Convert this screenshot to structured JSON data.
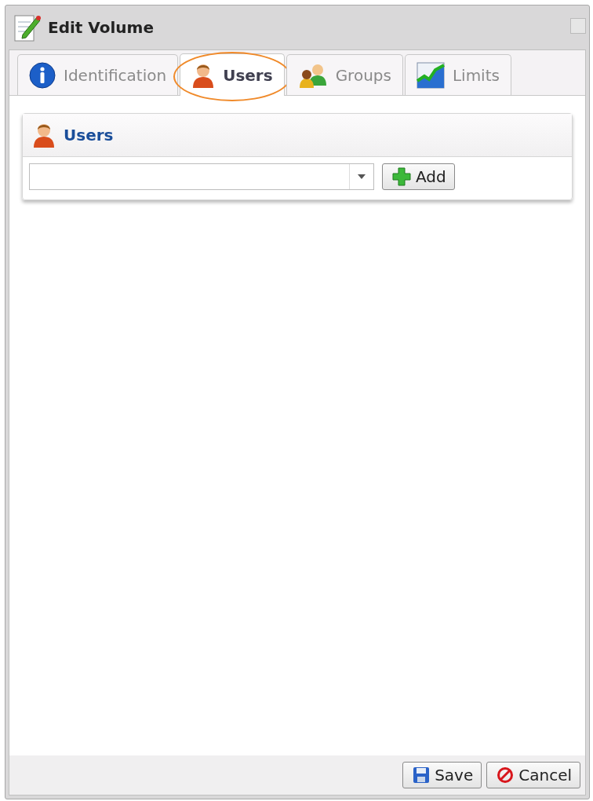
{
  "window": {
    "title": "Edit Volume"
  },
  "tabs": [
    {
      "label": "Identification",
      "kind": "info",
      "selected": false,
      "highlighted": false
    },
    {
      "label": "Users",
      "kind": "user",
      "selected": true,
      "highlighted": true
    },
    {
      "label": "Groups",
      "kind": "group",
      "selected": false,
      "highlighted": false
    },
    {
      "label": "Limits",
      "kind": "chart",
      "selected": false,
      "highlighted": false
    }
  ],
  "panel": {
    "title": "Users",
    "add_button": "Add"
  },
  "buttons": [
    {
      "label": "Save",
      "kind": "save"
    },
    {
      "label": "Cancel",
      "kind": "cancel"
    }
  ]
}
